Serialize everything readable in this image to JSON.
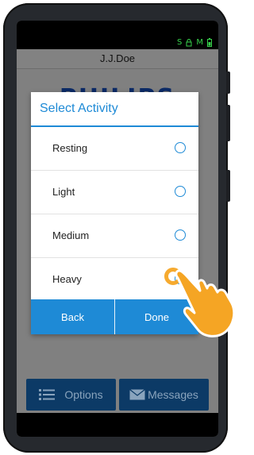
{
  "statusbar": {
    "sim_label": "S",
    "sim2_label": "M"
  },
  "header": {
    "user_name": "J.J.Doe"
  },
  "background": {
    "logo_text": "PHILIPS"
  },
  "dialog": {
    "title": "Select Activity",
    "options": [
      {
        "label": "Resting",
        "selected": false
      },
      {
        "label": "Light",
        "selected": false
      },
      {
        "label": "Medium",
        "selected": false
      },
      {
        "label": "Heavy",
        "selected": false
      }
    ],
    "back_label": "Back",
    "done_label": "Done"
  },
  "bottom_bar": {
    "options_label": "Options",
    "messages_label": "Messages"
  },
  "colors": {
    "accent": "#1e8ad6",
    "highlight": "#f5a524",
    "status_green": "#37d14b"
  }
}
